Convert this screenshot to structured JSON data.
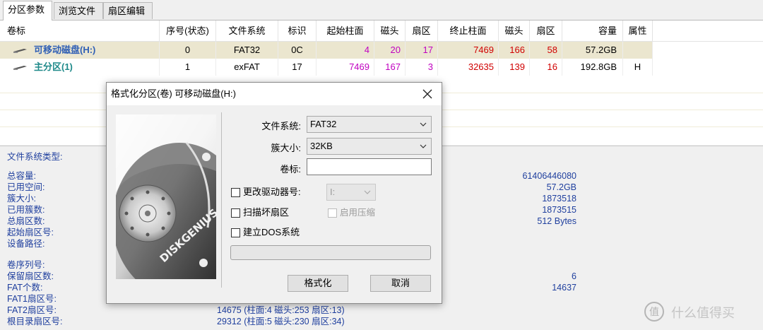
{
  "tabs": [
    "分区参数",
    "浏览文件",
    "扇区编辑"
  ],
  "table": {
    "headers": [
      "卷标",
      "序号(状态)",
      "文件系统",
      "标识",
      "起始柱面",
      "磁头",
      "扇区",
      "终止柱面",
      "磁头",
      "扇区",
      "容量",
      "属性"
    ],
    "rows": [
      {
        "label": "可移动磁盘(H:)",
        "index": "0",
        "fs": "FAT32",
        "id": "0C",
        "start_cyl": "4",
        "start_head": "20",
        "start_sec": "17",
        "end_cyl": "7469",
        "end_head": "166",
        "end_sec": "58",
        "capacity": "57.2GB",
        "attr": ""
      },
      {
        "label": "主分区(1)",
        "index": "1",
        "fs": "exFAT",
        "id": "17",
        "start_cyl": "7469",
        "start_head": "167",
        "start_sec": "3",
        "end_cyl": "32635",
        "end_head": "139",
        "end_sec": "16",
        "capacity": "192.8GB",
        "attr": "H"
      }
    ]
  },
  "info": {
    "fs_type_label": "文件系统类型:",
    "labels1": [
      "总容量:",
      "已用空间:",
      "簇大小:",
      "已用簇数:",
      "总扇区数:",
      "起始扇区号:",
      "设备路径:"
    ],
    "values1": [
      "61406446080",
      "57.2GB",
      "1873518",
      "1873515",
      "512 Bytes"
    ],
    "labels2": [
      "卷序列号:",
      "保留扇区数:",
      "FAT个数:",
      "FAT1扇区号:",
      "FAT2扇区号:",
      "根目录扇区号:"
    ],
    "values2": [
      "6",
      "14637"
    ],
    "fat2_value": "14675 (柱面:4 磁头:253 扇区:13)",
    "root_value": "29312 (柱面:5 磁头:230 扇区:34)"
  },
  "dialog": {
    "title": "格式化分区(卷) 可移动磁盘(H:)",
    "fs_label": "文件系统:",
    "fs_value": "FAT32",
    "cluster_label": "簇大小:",
    "cluster_value": "32KB",
    "volume_label": "卷标:",
    "volume_value": "",
    "change_drive_label": "更改驱动器号:",
    "drive_value": "I:",
    "scan_bad_label": "扫描坏扇区",
    "compress_label": "启用压缩",
    "dos_label": "建立DOS系统",
    "progress": 0,
    "format_button": "格式化",
    "cancel_button": "取消",
    "logo_text": "DISKGENIUS"
  },
  "watermark": "什么值得买",
  "colors": {
    "selected_row": "#ebe6cf",
    "partition1": "#2f5fb5",
    "partition2": "#1f8a8a",
    "magenta": "#c000c0",
    "red": "#d00000",
    "info_blue": "#1f3f9e"
  }
}
